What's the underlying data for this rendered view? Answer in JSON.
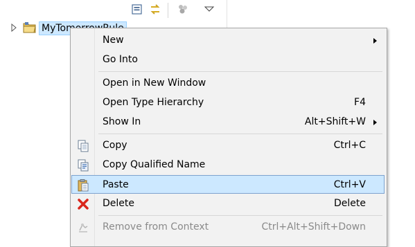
{
  "explorer": {
    "tree_item": "MyTomorrowRule",
    "toolbar_icons": [
      "collapse-all-icon",
      "link-with-editor-icon",
      "filter-icon",
      "view-menu-icon"
    ]
  },
  "menu": {
    "items": [
      {
        "label": "New",
        "key": "",
        "submenu": true
      },
      {
        "label": "Go Into",
        "key": ""
      },
      {
        "label": "Open in New Window",
        "key": ""
      },
      {
        "label": "Open Type Hierarchy",
        "key": "F4"
      },
      {
        "label": "Show In",
        "key": "Alt+Shift+W",
        "submenu": true
      },
      {
        "label": "Copy",
        "key": "Ctrl+C",
        "icon": "copy-icon"
      },
      {
        "label": "Copy Qualified Name",
        "key": "",
        "icon": "copy-qualified-name-icon"
      },
      {
        "label": "Paste",
        "key": "Ctrl+V",
        "icon": "paste-icon",
        "highlighted": true
      },
      {
        "label": "Delete",
        "key": "Delete",
        "icon": "delete-icon"
      },
      {
        "label": "Remove from Context",
        "key": "Ctrl+Alt+Shift+Down",
        "icon": "remove-from-context-icon",
        "disabled": true
      }
    ]
  },
  "colors": {
    "menu_background": "#f2f2f2",
    "highlight_background": "#cce8ff",
    "highlight_border": "#7da2ce",
    "selection_background": "#cde8ff",
    "delete_red": "#d9261c",
    "disabled_text": "#8a8a8a"
  }
}
